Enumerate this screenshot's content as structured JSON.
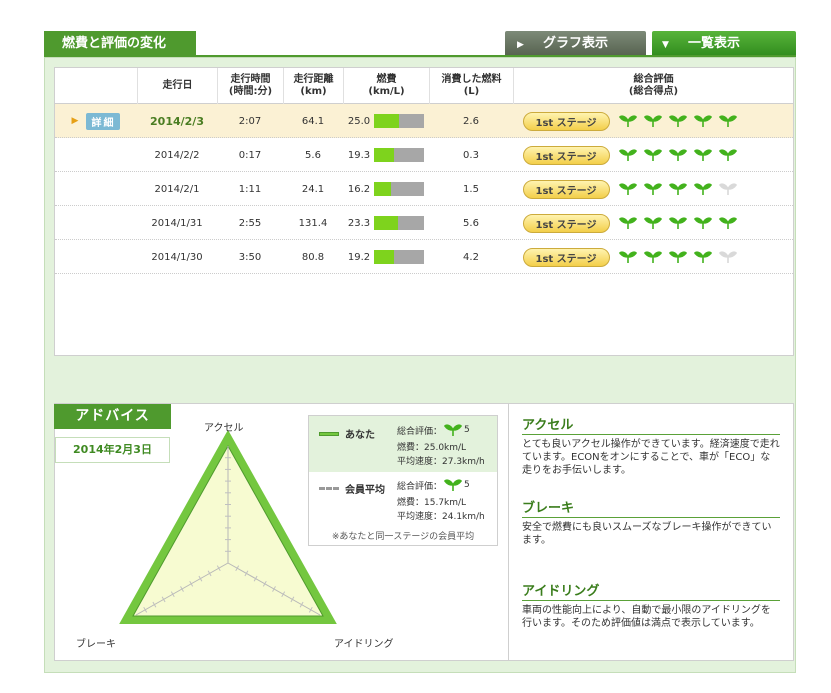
{
  "header": {
    "title": "燃費と評価の変化",
    "graph_button": "グラフ表示",
    "graph_button_icon": "▶",
    "list_button": "一覧表示",
    "list_button_icon": "▼"
  },
  "table": {
    "columns": {
      "date": "走行日",
      "time": "走行時間\n(時間:分)",
      "distance": "走行距離\n(km)",
      "fuel_economy": "燃費\n(km/L)",
      "fuel_used": "消費した燃料\n(L)",
      "rating": "総合評価\n(総合得点)"
    },
    "detail_label": "詳細",
    "rows": [
      {
        "date": "2014/2/3",
        "time": "2:07",
        "distance": "64.1",
        "economy": "25.0",
        "economy_ratio": 0.5,
        "fuel": "2.6",
        "stage": "1st ステージ",
        "sprouts": 5
      },
      {
        "date": "2014/2/2",
        "time": "0:17",
        "distance": "5.6",
        "economy": "19.3",
        "economy_ratio": 0.39,
        "fuel": "0.3",
        "stage": "1st ステージ",
        "sprouts": 5
      },
      {
        "date": "2014/2/1",
        "time": "1:11",
        "distance": "24.1",
        "economy": "16.2",
        "economy_ratio": 0.33,
        "fuel": "1.5",
        "stage": "1st ステージ",
        "sprouts": 4
      },
      {
        "date": "2014/1/31",
        "time": "2:55",
        "distance": "131.4",
        "economy": "23.3",
        "economy_ratio": 0.47,
        "fuel": "5.6",
        "stage": "1st ステージ",
        "sprouts": 5
      },
      {
        "date": "2014/1/30",
        "time": "3:50",
        "distance": "80.8",
        "economy": "19.2",
        "economy_ratio": 0.39,
        "fuel": "4.2",
        "stage": "1st ステージ",
        "sprouts": 4
      }
    ]
  },
  "advice": {
    "tab": "アドバイス",
    "date": "2014年2月3日",
    "axes": {
      "top": "アクセル",
      "left": "ブレーキ",
      "right": "アイドリング"
    },
    "legend": {
      "you_name": "あなた",
      "you_rating": "総合評価：",
      "you_score": "5",
      "you_economy": "燃費：25.0km/L",
      "you_speed": "平均速度：27.3km/h",
      "avg_name": "会員平均",
      "avg_rating": "総合評価：",
      "avg_score": "5",
      "avg_economy": "燃費：15.7km/L",
      "avg_speed": "平均速度：24.1km/h",
      "note": "※あなたと同一ステージの会員平均"
    },
    "sections": [
      {
        "title": "アクセル",
        "text": "とても良いアクセル操作ができています。経済速度で走れています。ECONをオンにすることで、車が「ECO」な走りをお手伝いします。"
      },
      {
        "title": "ブレーキ",
        "text": "安全で燃費にも良いスムーズなブレーキ操作ができています。"
      },
      {
        "title": "アイドリング",
        "text": "車両の性能向上により、自動で最小限のアイドリングを行います。そのため評価値は満点で表示しています。"
      }
    ]
  },
  "colors": {
    "accent_green": "#4f9a2e",
    "bar_fill": "#7ed31d",
    "sprout_on": "#43b21d",
    "sprout_off": "#d9d9d9"
  }
}
